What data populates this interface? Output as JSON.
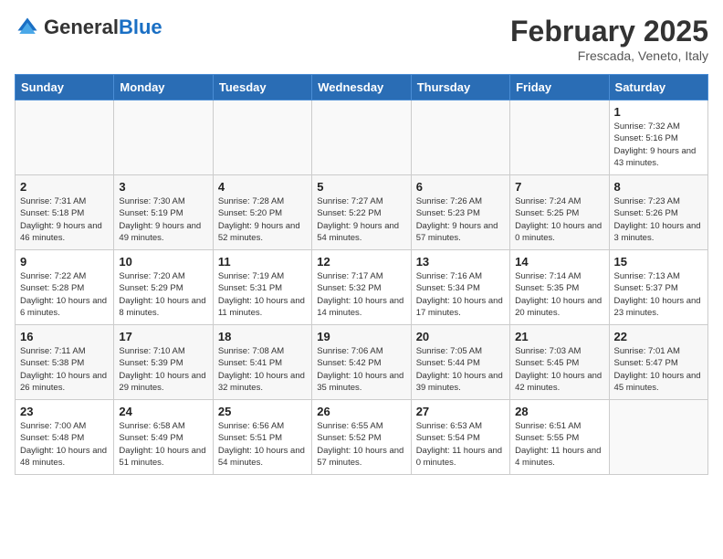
{
  "header": {
    "logo_general": "General",
    "logo_blue": "Blue",
    "month_title": "February 2025",
    "location": "Frescada, Veneto, Italy"
  },
  "calendar": {
    "days_of_week": [
      "Sunday",
      "Monday",
      "Tuesday",
      "Wednesday",
      "Thursday",
      "Friday",
      "Saturday"
    ],
    "weeks": [
      [
        {
          "day": "",
          "info": ""
        },
        {
          "day": "",
          "info": ""
        },
        {
          "day": "",
          "info": ""
        },
        {
          "day": "",
          "info": ""
        },
        {
          "day": "",
          "info": ""
        },
        {
          "day": "",
          "info": ""
        },
        {
          "day": "1",
          "info": "Sunrise: 7:32 AM\nSunset: 5:16 PM\nDaylight: 9 hours and 43 minutes."
        }
      ],
      [
        {
          "day": "2",
          "info": "Sunrise: 7:31 AM\nSunset: 5:18 PM\nDaylight: 9 hours and 46 minutes."
        },
        {
          "day": "3",
          "info": "Sunrise: 7:30 AM\nSunset: 5:19 PM\nDaylight: 9 hours and 49 minutes."
        },
        {
          "day": "4",
          "info": "Sunrise: 7:28 AM\nSunset: 5:20 PM\nDaylight: 9 hours and 52 minutes."
        },
        {
          "day": "5",
          "info": "Sunrise: 7:27 AM\nSunset: 5:22 PM\nDaylight: 9 hours and 54 minutes."
        },
        {
          "day": "6",
          "info": "Sunrise: 7:26 AM\nSunset: 5:23 PM\nDaylight: 9 hours and 57 minutes."
        },
        {
          "day": "7",
          "info": "Sunrise: 7:24 AM\nSunset: 5:25 PM\nDaylight: 10 hours and 0 minutes."
        },
        {
          "day": "8",
          "info": "Sunrise: 7:23 AM\nSunset: 5:26 PM\nDaylight: 10 hours and 3 minutes."
        }
      ],
      [
        {
          "day": "9",
          "info": "Sunrise: 7:22 AM\nSunset: 5:28 PM\nDaylight: 10 hours and 6 minutes."
        },
        {
          "day": "10",
          "info": "Sunrise: 7:20 AM\nSunset: 5:29 PM\nDaylight: 10 hours and 8 minutes."
        },
        {
          "day": "11",
          "info": "Sunrise: 7:19 AM\nSunset: 5:31 PM\nDaylight: 10 hours and 11 minutes."
        },
        {
          "day": "12",
          "info": "Sunrise: 7:17 AM\nSunset: 5:32 PM\nDaylight: 10 hours and 14 minutes."
        },
        {
          "day": "13",
          "info": "Sunrise: 7:16 AM\nSunset: 5:34 PM\nDaylight: 10 hours and 17 minutes."
        },
        {
          "day": "14",
          "info": "Sunrise: 7:14 AM\nSunset: 5:35 PM\nDaylight: 10 hours and 20 minutes."
        },
        {
          "day": "15",
          "info": "Sunrise: 7:13 AM\nSunset: 5:37 PM\nDaylight: 10 hours and 23 minutes."
        }
      ],
      [
        {
          "day": "16",
          "info": "Sunrise: 7:11 AM\nSunset: 5:38 PM\nDaylight: 10 hours and 26 minutes."
        },
        {
          "day": "17",
          "info": "Sunrise: 7:10 AM\nSunset: 5:39 PM\nDaylight: 10 hours and 29 minutes."
        },
        {
          "day": "18",
          "info": "Sunrise: 7:08 AM\nSunset: 5:41 PM\nDaylight: 10 hours and 32 minutes."
        },
        {
          "day": "19",
          "info": "Sunrise: 7:06 AM\nSunset: 5:42 PM\nDaylight: 10 hours and 35 minutes."
        },
        {
          "day": "20",
          "info": "Sunrise: 7:05 AM\nSunset: 5:44 PM\nDaylight: 10 hours and 39 minutes."
        },
        {
          "day": "21",
          "info": "Sunrise: 7:03 AM\nSunset: 5:45 PM\nDaylight: 10 hours and 42 minutes."
        },
        {
          "day": "22",
          "info": "Sunrise: 7:01 AM\nSunset: 5:47 PM\nDaylight: 10 hours and 45 minutes."
        }
      ],
      [
        {
          "day": "23",
          "info": "Sunrise: 7:00 AM\nSunset: 5:48 PM\nDaylight: 10 hours and 48 minutes."
        },
        {
          "day": "24",
          "info": "Sunrise: 6:58 AM\nSunset: 5:49 PM\nDaylight: 10 hours and 51 minutes."
        },
        {
          "day": "25",
          "info": "Sunrise: 6:56 AM\nSunset: 5:51 PM\nDaylight: 10 hours and 54 minutes."
        },
        {
          "day": "26",
          "info": "Sunrise: 6:55 AM\nSunset: 5:52 PM\nDaylight: 10 hours and 57 minutes."
        },
        {
          "day": "27",
          "info": "Sunrise: 6:53 AM\nSunset: 5:54 PM\nDaylight: 11 hours and 0 minutes."
        },
        {
          "day": "28",
          "info": "Sunrise: 6:51 AM\nSunset: 5:55 PM\nDaylight: 11 hours and 4 minutes."
        },
        {
          "day": "",
          "info": ""
        }
      ]
    ]
  }
}
